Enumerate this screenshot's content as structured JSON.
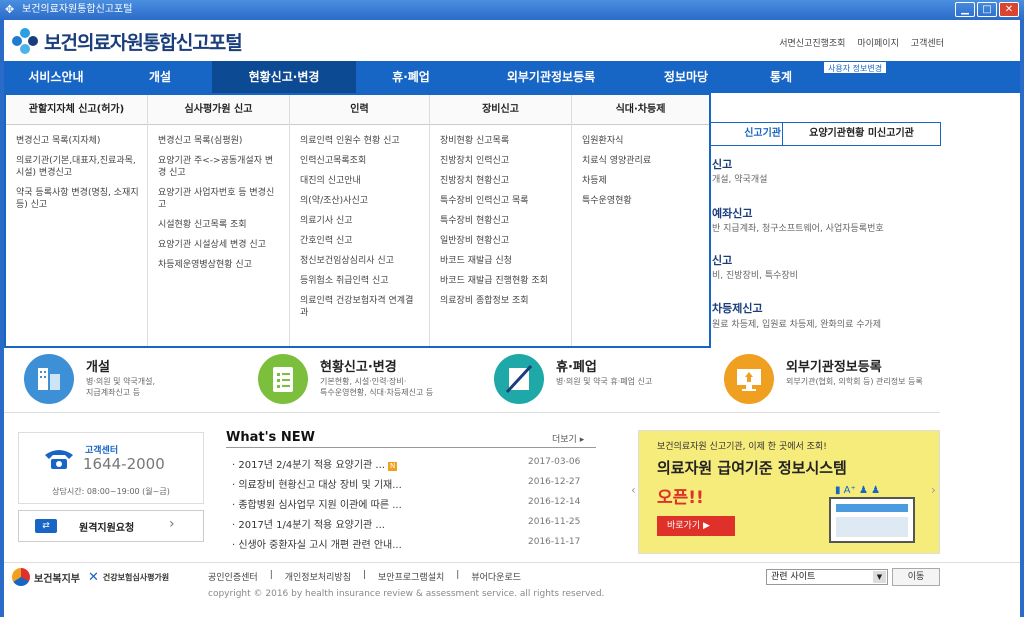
{
  "window": {
    "title": "보건의료자원통합신고포털"
  },
  "header": {
    "logo_text": "보건의료자원통합신고포털",
    "util_links": [
      "서면신고진행조회",
      "마이페이지",
      "고객센터"
    ]
  },
  "gnb": {
    "items": [
      "서비스안내",
      "개설",
      "현황신고·변경",
      "휴·폐업",
      "외부기관정보등록",
      "정보마당",
      "통계"
    ],
    "admin_badge": "사용자 정보변경"
  },
  "dropdown": {
    "columns": [
      {
        "title": "관할지자체 신고(허가)",
        "items": [
          "변경신고 목록(지자체)",
          "의료기관(기본,대표자,진료과목,시설) 변경신고",
          "약국 등록사항 변경(명칭, 소재지 등) 신고"
        ]
      },
      {
        "title": "심사평가원 신고",
        "items": [
          "변경신고 목록(심평원)",
          "요양기관 주<->공동개설자 변경 신고",
          "요양기관 사업자번호 등 변경신고",
          "시설현황 신고목록 조회",
          "요양기관 시설상세 변경 신고",
          "차등제운영병상현황 신고"
        ]
      },
      {
        "title": "인력",
        "items": [
          "의료인력 인원수 현황 신고",
          "인력신고목록조회",
          "대진의 신고안내",
          "의(약/조산)사신고",
          "의료기사 신고",
          "간호인력 신고",
          "정신보건임상심리사 신고",
          "등위험소 취급인력 신고",
          "의료인력 건강보험자격 연계결과"
        ]
      },
      {
        "title": "장비신고",
        "items": [
          "장비현황 신고목록",
          "진방장치 인력신고",
          "진방장치 현황신고",
          "특수장비 인력신고 목록",
          "특수장비 현황신고",
          "일반장비 현황신고",
          "바코드 재발급 신청",
          "바코드 재발급 진행현황 조회",
          "의료장비 종합정보 조회"
        ]
      },
      {
        "title": "식대·차등제",
        "items": [
          "입원환자식",
          "치료식 영양관리료",
          "차등제",
          "특수운영현황"
        ]
      }
    ]
  },
  "right_panel": {
    "tabs": [
      "신고기관",
      "요양기관현황 미신고기관"
    ],
    "sections": [
      {
        "title": "신고",
        "desc": "개설, 약국개설"
      },
      {
        "title": "예좌신고",
        "desc": "반 지급계좌, 청구소프트웨어, 사업자등록번호"
      },
      {
        "title": "신고",
        "desc": "비, 진방장비, 특수장비"
      },
      {
        "title": "차등제신고",
        "desc": "원료 차등제, 입원료 차등제, 완화의료 수가제"
      }
    ]
  },
  "quick_menu": [
    {
      "title": "개설",
      "desc": "병·의원 및 약국개설,\n지급계좌신고 등",
      "color": "#3d8fd6",
      "icon": "building-icon"
    },
    {
      "title": "현황신고·변경",
      "desc": "기본현황, 시설·인력·장비·\n특수운영현황, 식대·차등제신고 등",
      "color": "#7cbf3c",
      "icon": "checklist-icon"
    },
    {
      "title": "휴·폐업",
      "desc": "병·의원 및 약국 휴·폐업 신고",
      "color": "#1ea8a8",
      "icon": "closed-icon"
    },
    {
      "title": "외부기관정보등록",
      "desc": "외부기관(협회, 의학회 등) 관리정보 등록",
      "color": "#f0a020",
      "icon": "monitor-icon"
    }
  ],
  "customer_center": {
    "label": "고객센터",
    "phone": "1644-2000",
    "hours": "상담시간: 08:00~19:00 (월~금)",
    "remote_label": "원격지원요청"
  },
  "news": {
    "title": "What's NEW",
    "more": "더보기",
    "items": [
      {
        "title": "2017년 2/4분기 적용 요양기관 ...",
        "date": "2017-03-06",
        "new": true
      },
      {
        "title": "의료장비 현황신고 대상 장비 및 기재...",
        "date": "2016-12-27",
        "new": false
      },
      {
        "title": "종합병원 심사업무 지원 이관에 따른 ...",
        "date": "2016-12-14",
        "new": false
      },
      {
        "title": "2017년 1/4분기 적용 요양기관 ...",
        "date": "2016-11-25",
        "new": false
      },
      {
        "title": "신생아 중환자실 고시 개편 관련 안내...",
        "date": "2016-11-17",
        "new": false
      }
    ]
  },
  "banner": {
    "top": "보건의료자원 신고기관, 이제 한 곳에서 조회!",
    "headline": "의료자원 급여기준 정보시스템",
    "open": "오픈!!",
    "button": "바로가기"
  },
  "footer": {
    "org1": "보건복지부",
    "org2": "건강보험심사평가원",
    "links": [
      "공인인증센터",
      "개인정보처리방침",
      "보안프로그램설치",
      "뷰어다운로드"
    ],
    "copyright": "copyright © 2016 by health insurance review & assessment service. all rights reserved.",
    "related_select": "관련 사이트",
    "go": "이동"
  }
}
